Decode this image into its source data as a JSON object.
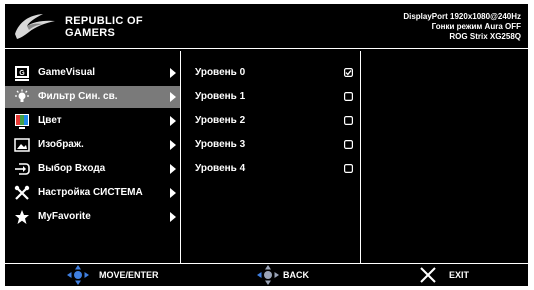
{
  "header": {
    "brand_line1": "REPUBLIC OF",
    "brand_line2": "GAMERS",
    "info_line1": "DisplayPort 1920x1080@240Hz",
    "info_line2": "Гонки режим  Aura OFF",
    "info_line3": "ROG Strix XG258Q"
  },
  "main_menu": {
    "items": [
      {
        "label": "GameVisual",
        "icon": "gamevisual-icon",
        "selected": false
      },
      {
        "label": "Фильтр Син. св.",
        "icon": "blue-light-bulb-icon",
        "selected": true
      },
      {
        "label": "Цвет",
        "icon": "color-icon",
        "selected": false
      },
      {
        "label": "Изображ.",
        "icon": "image-icon",
        "selected": false
      },
      {
        "label": "Выбор Входа",
        "icon": "input-select-icon",
        "selected": false
      },
      {
        "label": "Настройка СИСТЕМА",
        "icon": "tools-icon",
        "selected": false
      },
      {
        "label": "MyFavorite",
        "icon": "star-icon",
        "selected": false
      }
    ]
  },
  "sub_menu": {
    "items": [
      {
        "label": "Уровень 0",
        "checked": true
      },
      {
        "label": "Уровень 1",
        "checked": false
      },
      {
        "label": "Уровень 2",
        "checked": false
      },
      {
        "label": "Уровень 3",
        "checked": false
      },
      {
        "label": "Уровень 4",
        "checked": false
      }
    ]
  },
  "footer": {
    "move_label": "MOVE/ENTER",
    "back_label": "BACK",
    "exit_label": "EXIT"
  },
  "colors": {
    "background": "#000000",
    "selected_row": "#7a7a7a",
    "joystick_blue": "#3f7fe0",
    "exit_x": "#ffffff"
  }
}
